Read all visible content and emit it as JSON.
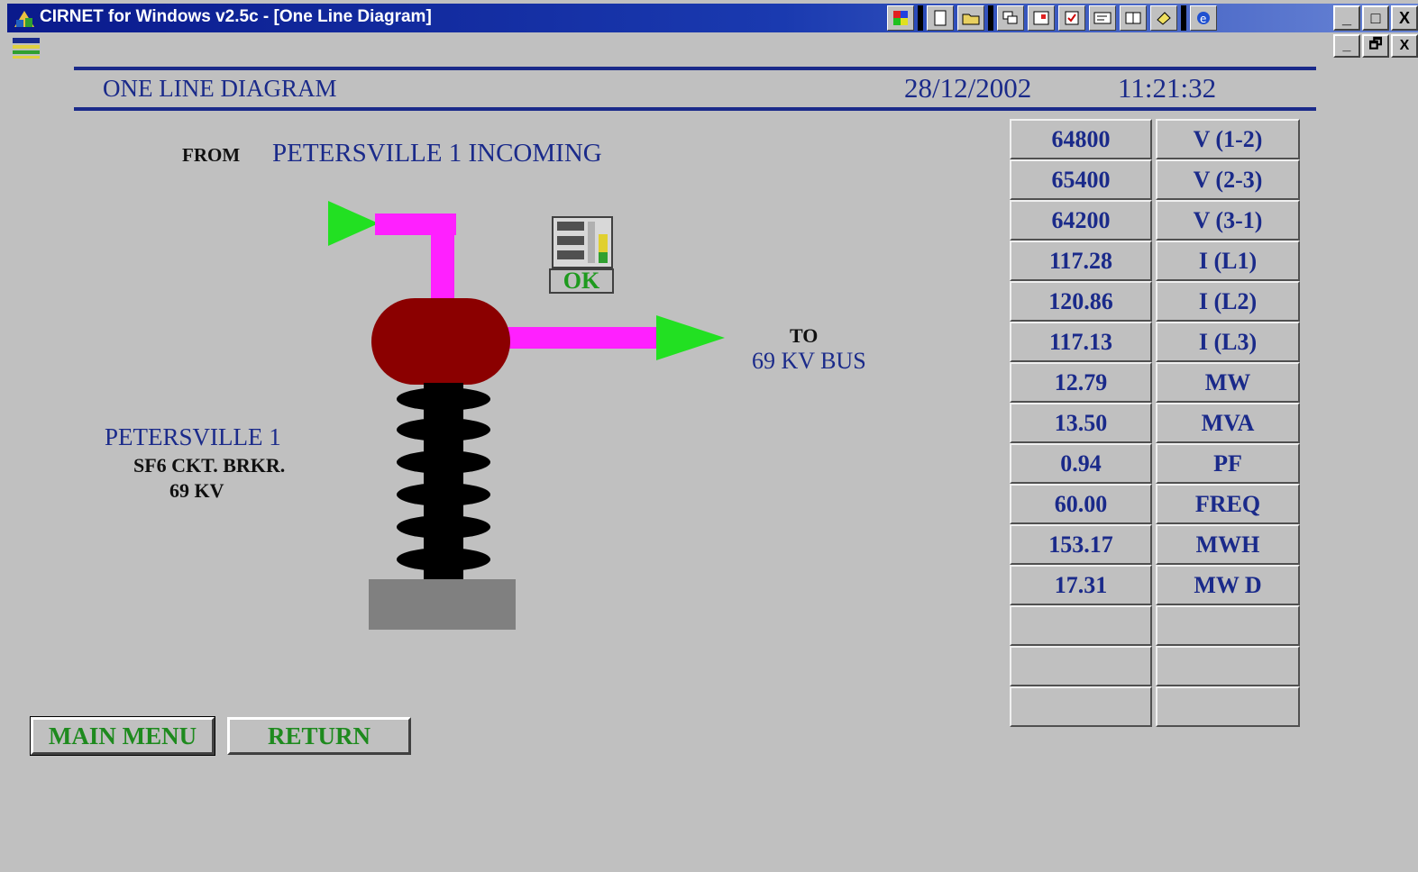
{
  "window": {
    "title": "CIRNET for Windows v2.5c - [One Line Diagram]",
    "minimize": "_",
    "maximize": "□",
    "close": "X",
    "restore": "🗗"
  },
  "header": {
    "title": "ONE LINE DIAGRAM",
    "date": "28/12/2002",
    "time": "11:21:32"
  },
  "diagram": {
    "from_label": "FROM",
    "from_value": "PETERSVILLE 1 INCOMING",
    "to_label": "TO",
    "to_value": "69 KV BUS",
    "breaker_name": "PETERSVILLE 1",
    "breaker_type": "SF6 CKT. BRKR.",
    "breaker_voltage": "69 KV",
    "status": "OK",
    "colors": {
      "line": "#ff20ff",
      "arrow": "#22e022",
      "breaker": "#8b0000",
      "insulator": "#000000",
      "base": "#808080"
    }
  },
  "readings": [
    {
      "value": "64800",
      "label": "V (1-2)"
    },
    {
      "value": "65400",
      "label": "V (2-3)"
    },
    {
      "value": "64200",
      "label": "V (3-1)"
    },
    {
      "value": "117.28",
      "label": "I (L1)"
    },
    {
      "value": "120.86",
      "label": "I (L2)"
    },
    {
      "value": "117.13",
      "label": "I (L3)"
    },
    {
      "value": "12.79",
      "label": "MW"
    },
    {
      "value": "13.50",
      "label": "MVA"
    },
    {
      "value": "0.94",
      "label": "PF"
    },
    {
      "value": "60.00",
      "label": "FREQ"
    },
    {
      "value": "153.17",
      "label": "MWH"
    },
    {
      "value": "17.31",
      "label": "MW D"
    },
    {
      "value": "",
      "label": ""
    },
    {
      "value": "",
      "label": ""
    },
    {
      "value": "",
      "label": ""
    }
  ],
  "buttons": {
    "main_menu": "MAIN MENU",
    "return": "RETURN"
  }
}
